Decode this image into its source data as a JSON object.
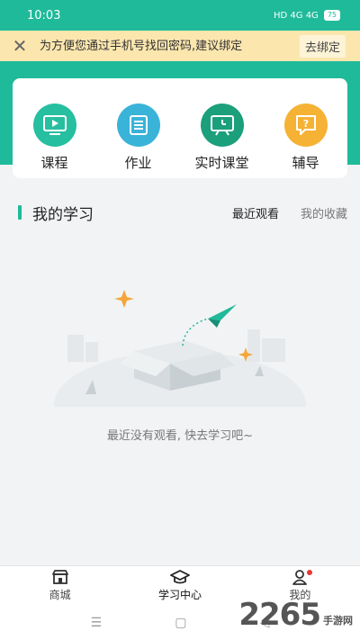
{
  "status_bar": {
    "time": "10:03",
    "indicators": "HD 4G 4G",
    "battery": "75"
  },
  "banner": {
    "close_icon": "close-icon",
    "text": "为方便您通过手机号找回密码,建议绑定",
    "button": "去绑定"
  },
  "menu": {
    "items": [
      {
        "label": "课程",
        "icon": "play-screen-icon",
        "color": "#26bfa0"
      },
      {
        "label": "作业",
        "icon": "list-doc-icon",
        "color": "#3ab3d8"
      },
      {
        "label": "实时课堂",
        "icon": "live-class-icon",
        "color": "#1c9f7b"
      },
      {
        "label": "辅导",
        "icon": "question-chat-icon",
        "color": "#f6b234"
      }
    ]
  },
  "study": {
    "title": "我的学习",
    "tabs": [
      {
        "label": "最近观看",
        "active": true
      },
      {
        "label": "我的收藏",
        "active": false
      }
    ],
    "empty_text": "最近没有观看, 快去学习吧~"
  },
  "bottom_nav": {
    "items": [
      {
        "label": "商城",
        "icon": "store-icon"
      },
      {
        "label": "学习中心",
        "icon": "graduation-cap-icon",
        "active": true
      },
      {
        "label": "我的",
        "icon": "user-icon"
      }
    ]
  },
  "watermark": {
    "number": "2265",
    "site": "手游网"
  }
}
